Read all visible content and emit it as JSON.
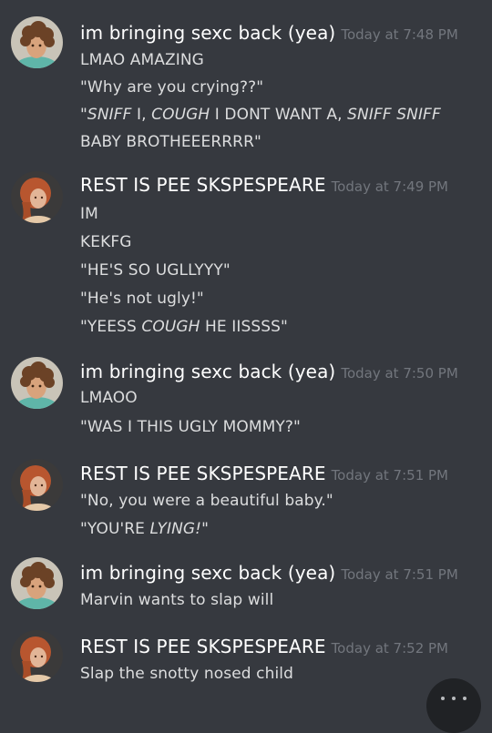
{
  "users": {
    "a": {
      "name": "im bringing sexc back (yea)",
      "avatar_icon": "curly-hair-boy-avatar"
    },
    "b": {
      "name": "REST IS PEE SKSPESPEARE",
      "avatar_icon": "red-hair-woman-avatar"
    }
  },
  "messages": [
    {
      "user": "a",
      "time": "Today at 7:48 PM",
      "lines": [
        [
          "LMAO AMAZING"
        ],
        [
          "\"Why are you crying??\""
        ],
        [
          "\"",
          "SNIFF",
          " I, ",
          "COUGH",
          " I DONT WANT A, ",
          "SNIFF SNIFF"
        ],
        [
          "BABY BROTHEEERRRR\""
        ]
      ]
    },
    {
      "user": "b",
      "time": "Today at 7:49 PM",
      "lines": [
        [
          "IM"
        ],
        [
          "KEKFG"
        ],
        [
          "\"HE'S SO UGLLYYY\""
        ],
        [
          "\"He's not ugly!\""
        ],
        [
          "\"YEESS ",
          "COUGH",
          " HE IISSSS\""
        ]
      ]
    },
    {
      "user": "a",
      "time": "Today at 7:50 PM",
      "lines": [
        [
          "LMAOO"
        ],
        [
          "\"WAS I THIS UGLY MOMMY?\""
        ]
      ]
    },
    {
      "user": "b",
      "time": "Today at 7:51 PM",
      "lines": [
        [
          "\"No, you were a beautiful baby.\""
        ],
        [
          "\"YOU'RE ",
          "LYING!",
          "\""
        ]
      ]
    },
    {
      "user": "a",
      "time": "Today at 7:51 PM",
      "lines": [
        [
          "Marvin wants to slap will"
        ]
      ]
    },
    {
      "user": "b",
      "time": "Today at 7:52 PM",
      "lines": [
        [
          "Slap the snotty nosed child"
        ]
      ]
    }
  ],
  "colors": {
    "background": "#36393f",
    "username": "#ffffff",
    "timestamp": "#72767d",
    "message_text": "#dcddde"
  }
}
